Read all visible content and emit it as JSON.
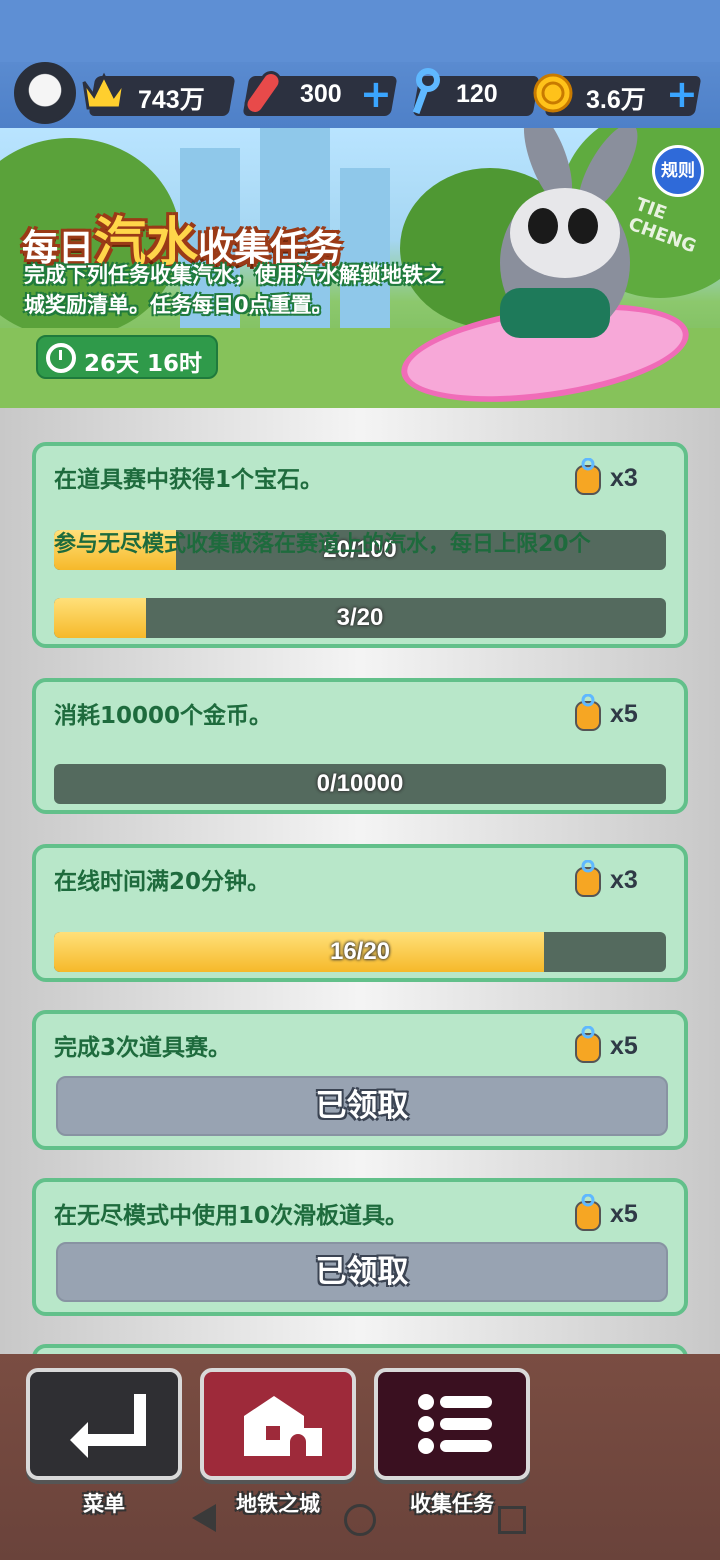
{
  "top_bar": {
    "crowns": "743万",
    "boards": "300",
    "keys": "120",
    "coins": "3.6万"
  },
  "banner": {
    "title_part1": "每日",
    "title_part2": "汽水",
    "title_part3": "收集任务",
    "desc": "完成下列任务收集汽水，使用汽水解锁地铁之城奖励清单。任务每日0点重置。",
    "timer": "26天 16时",
    "rules": "规则",
    "sign": "TIE CHENG"
  },
  "tasks": [
    {
      "title": "在道具赛中获得1个宝石。",
      "reward": "x3",
      "progress_label": "20/100",
      "progress": 0.2,
      "overlay_text": "参与无尽模式收集散落在赛道上的汽水，每日上限20个"
    },
    {
      "title": "",
      "reward": "",
      "progress_label": "3/20",
      "progress": 0.15
    },
    {
      "title": "消耗10000个金币。",
      "reward": "x5",
      "progress_label": "0/10000",
      "progress": 0.0
    },
    {
      "title": "在线时间满20分钟。",
      "reward": "x3",
      "progress_label": "16/20",
      "progress": 0.8
    },
    {
      "title": "完成3次道具赛。",
      "reward": "x5",
      "claimed_label": "已领取"
    },
    {
      "title": "在无尽模式中使用10次滑板道具。",
      "reward": "x5",
      "claimed_label": "已领取"
    }
  ],
  "bottom_nav": {
    "menu": "菜单",
    "city": "地铁之城",
    "tasks": "收集任务"
  },
  "colors": {
    "card_bg": "#b8e7c9",
    "card_border": "#62c08a",
    "bar_fill": "#f6b92a",
    "bar_bg": "#546a5e",
    "claimed_bg": "#98a3b2"
  }
}
